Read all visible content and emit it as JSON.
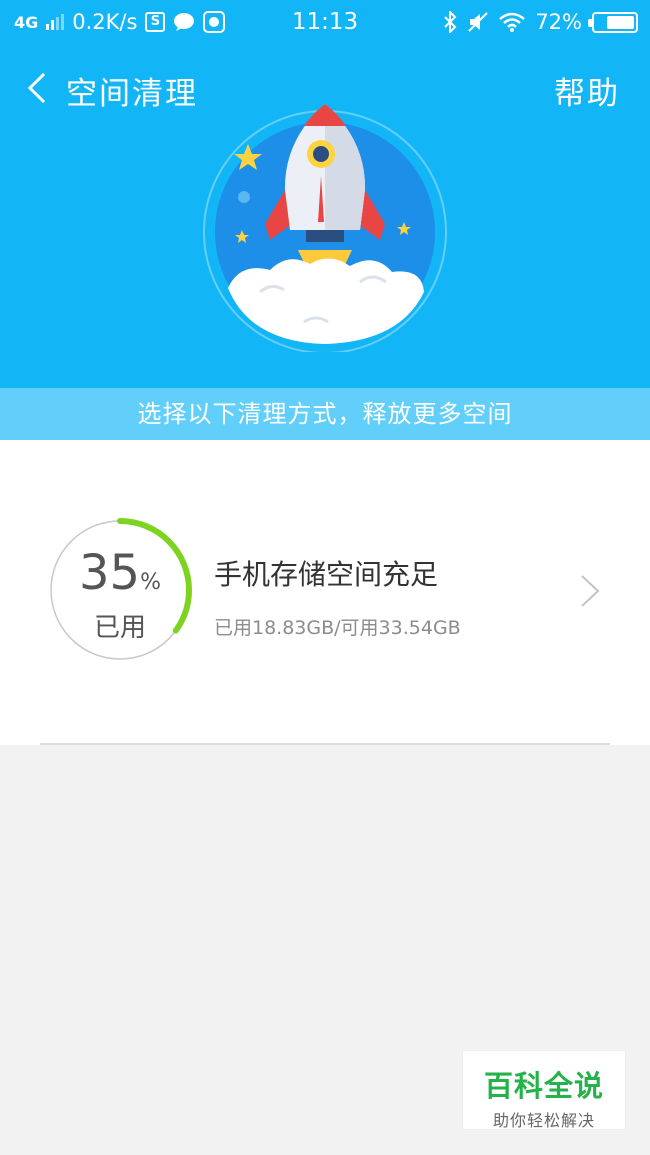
{
  "status_bar": {
    "network": "4G",
    "speed": "0.2K/s",
    "time": "11:13",
    "battery": "72%",
    "battery_level": 0.72
  },
  "nav": {
    "title": "空间清理",
    "help": "帮助"
  },
  "banner": {
    "text": "选择以下清理方式，释放更多空间"
  },
  "storage": {
    "percent": "35",
    "percent_unit": "%",
    "used_label": "已用",
    "used_fraction": 0.35,
    "title": "手机存储空间充足",
    "detail": "已用18.83GB/可用33.54GB"
  },
  "watermark": {
    "title": "百科全说",
    "subtitle": "助你轻松解决"
  },
  "colors": {
    "header_bg": "#12b6f7",
    "banner_bg": "#62cffa",
    "gauge_progress": "#7ed321",
    "gauge_track": "#c8c8c8"
  }
}
